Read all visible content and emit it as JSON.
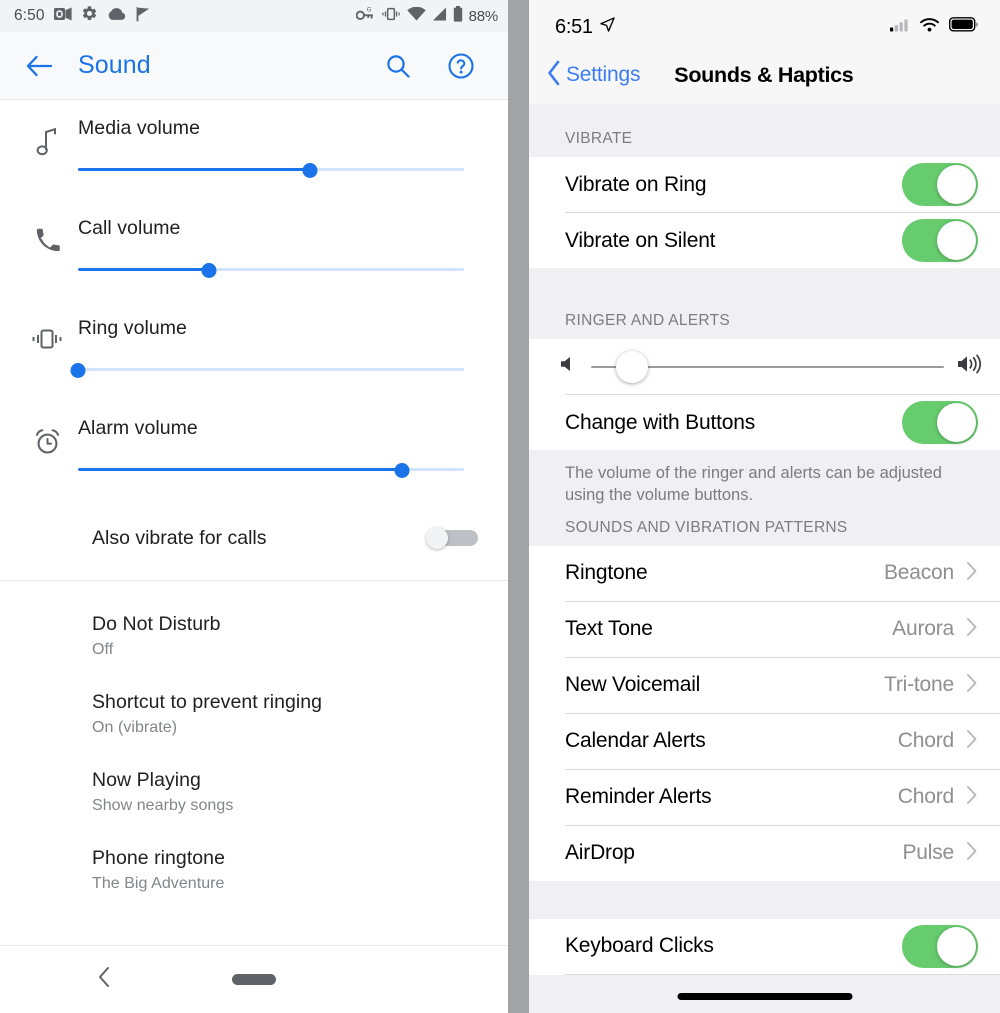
{
  "android": {
    "status_bar": {
      "time": "6:50",
      "battery_percent": "88%",
      "left_icons": [
        "outlook-icon",
        "gear-icon",
        "cloud-icon",
        "flag-check-icon"
      ],
      "right_icons": [
        "vpn-key-icon",
        "vibrate-icon",
        "wifi-icon",
        "signal-icon",
        "battery-icon"
      ]
    },
    "app_bar": {
      "back_icon": "arrow-left-icon",
      "title": "Sound",
      "search_icon": "search-icon",
      "help_icon": "help-circle-icon",
      "title_color": "#1a73e8"
    },
    "sliders": [
      {
        "icon": "music-note-icon",
        "label": "Media volume",
        "value": 60
      },
      {
        "icon": "phone-icon",
        "label": "Call volume",
        "value": 34
      },
      {
        "icon": "vibrate-icon",
        "label": "Ring volume",
        "value": 0
      },
      {
        "icon": "alarm-clock-icon",
        "label": "Alarm volume",
        "value": 84
      }
    ],
    "vibrate_for_calls": {
      "label": "Also vibrate for calls",
      "enabled": false
    },
    "list_items": [
      {
        "title": "Do Not Disturb",
        "subtitle": "Off"
      },
      {
        "title": "Shortcut to prevent ringing",
        "subtitle": "On (vibrate)"
      },
      {
        "title": "Now Playing",
        "subtitle": "Show nearby songs"
      },
      {
        "title": "Phone ringtone",
        "subtitle": "The Big Adventure"
      }
    ],
    "nav_bar": {
      "back_icon": "chevron-left-icon",
      "home_pill": "home-pill-handle"
    }
  },
  "ios": {
    "status_bar": {
      "time": "6:51",
      "location_icon": "location-arrow-icon",
      "right_icons": [
        "cellular-signal-icon",
        "wifi-icon",
        "battery-icon"
      ]
    },
    "nav_bar": {
      "back_icon": "chevron-left-icon",
      "back_label": "Settings",
      "title": "Sounds & Haptics"
    },
    "vibrate_section": {
      "header": "VIBRATE",
      "rows": [
        {
          "label": "Vibrate on Ring",
          "enabled": true
        },
        {
          "label": "Vibrate on Silent",
          "enabled": true
        }
      ]
    },
    "ringer_section": {
      "header": "RINGER AND ALERTS",
      "volume": 10,
      "low_icon": "speaker-low-icon",
      "high_icon": "speaker-high-icon",
      "change_with_buttons": {
        "label": "Change with Buttons",
        "enabled": true
      },
      "footnote": "The volume of the ringer and alerts can be adjusted using the volume buttons."
    },
    "sounds_section": {
      "header": "SOUNDS AND VIBRATION PATTERNS",
      "rows": [
        {
          "label": "Ringtone",
          "value": "Beacon"
        },
        {
          "label": "Text Tone",
          "value": "Aurora"
        },
        {
          "label": "New Voicemail",
          "value": "Tri-tone"
        },
        {
          "label": "Calendar Alerts",
          "value": "Chord"
        },
        {
          "label": "Reminder Alerts",
          "value": "Chord"
        },
        {
          "label": "AirDrop",
          "value": "Pulse"
        }
      ],
      "disclosure_icon": "chevron-right-icon"
    },
    "keyboard_section": {
      "rows": [
        {
          "label": "Keyboard Clicks",
          "enabled": true
        }
      ]
    },
    "home_indicator": "home-indicator-bar"
  },
  "colors": {
    "android_accent": "#1a73e8",
    "android_track": "#d2e3fc",
    "ios_switch_on": "#67cc6e",
    "ios_link": "#3b7cf5",
    "ios_group_bg": "#efeff4"
  }
}
